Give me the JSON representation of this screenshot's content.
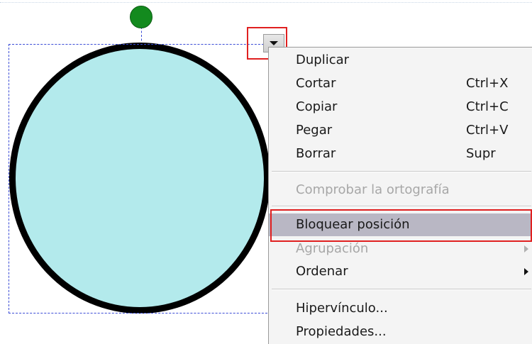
{
  "menu": {
    "items": [
      {
        "label": "Duplicar",
        "shortcut": ""
      },
      {
        "label": "Cortar",
        "shortcut": "Ctrl+X"
      },
      {
        "label": "Copiar",
        "shortcut": "Ctrl+C"
      },
      {
        "label": "Pegar",
        "shortcut": "Ctrl+V"
      },
      {
        "label": "Borrar",
        "shortcut": "Supr"
      },
      {
        "label": "Comprobar la ortografía",
        "shortcut": "",
        "disabled": true
      },
      {
        "label": "Bloquear posición",
        "shortcut": "",
        "selected": true
      },
      {
        "label": "Agrupación",
        "shortcut": "",
        "disabled": true,
        "submenu": true
      },
      {
        "label": "Ordenar",
        "shortcut": "",
        "submenu": true
      },
      {
        "label": "Hipervínculo...",
        "shortcut": ""
      },
      {
        "label": "Propiedades...",
        "shortcut": ""
      }
    ]
  },
  "colors": {
    "shape_fill": "#b3eaec",
    "shape_border": "#000000",
    "rotate_handle": "#138a1e",
    "selection_border": "#3a4bd6",
    "highlight_frame": "#e02020",
    "menu_selected_bg": "#b9b7c4"
  }
}
